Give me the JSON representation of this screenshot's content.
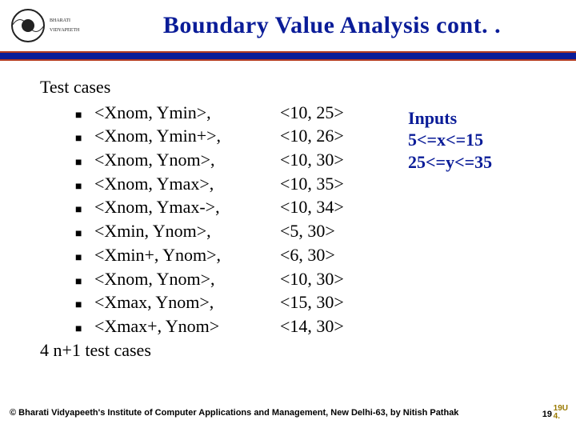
{
  "header": {
    "title": "Boundary Value Analysis cont. ."
  },
  "content": {
    "heading": "Test cases",
    "rows": [
      {
        "label": "<Xnom, Ymin>,",
        "value": "<10, 25>"
      },
      {
        "label": "<Xnom, Ymin+>,",
        "value": "<10, 26>"
      },
      {
        "label": "<Xnom, Ynom>,",
        "value": "<10, 30>"
      },
      {
        "label": "<Xnom, Ymax>,",
        "value": "<10, 35>"
      },
      {
        "label": "<Xnom, Ymax->,",
        "value": "<10, 34>"
      },
      {
        "label": "<Xmin, Ynom>,",
        "value": "<5, 30>"
      },
      {
        "label": "<Xmin+, Ynom>,",
        "value": "<6, 30>"
      },
      {
        "label": "<Xnom, Ynom>,",
        "value": "<10, 30>"
      },
      {
        "label": "<Xmax, Ynom>,",
        "value": "<15, 30>"
      },
      {
        "label": "<Xmax+, Ynom>",
        "value": "<14, 30>"
      }
    ],
    "footer_line": "4 n+1 test cases",
    "inputs": {
      "title": "Inputs",
      "line1": "5<=x<=15",
      "line2": "25<=y<=35"
    }
  },
  "footer": {
    "copyright": "© Bharati Vidyapeeth's Institute of Computer Applications and Management, New Delhi-63, by  Nitish Pathak",
    "page": "19",
    "page_extra_top": "19U",
    "page_extra_bottom": "4."
  }
}
